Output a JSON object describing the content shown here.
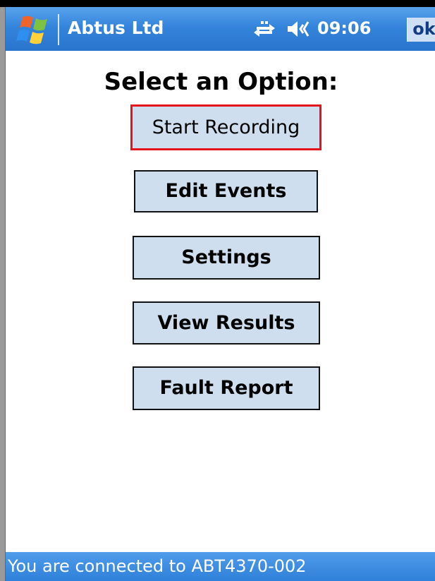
{
  "titlebar": {
    "app_title": "Abtus Ltd",
    "clock": "09:06",
    "ok_label": "ok",
    "icons": {
      "start": "windows-start-icon",
      "connectivity": "connectivity-icon",
      "volume": "volume-icon"
    }
  },
  "main": {
    "heading": "Select an Option:",
    "buttons": [
      {
        "label": "Start Recording",
        "state": "focused"
      },
      {
        "label": "Edit Events"
      },
      {
        "label": "Settings"
      },
      {
        "label": "View Results"
      },
      {
        "label": "Fault Report"
      }
    ]
  },
  "statusbar": {
    "text": "You are connected to ABT4370-002"
  },
  "colors": {
    "titlebar": "#3484dc",
    "button_fill": "#cfdeef",
    "focus_border": "#e4141c",
    "statusbar": "#3a87dc"
  }
}
